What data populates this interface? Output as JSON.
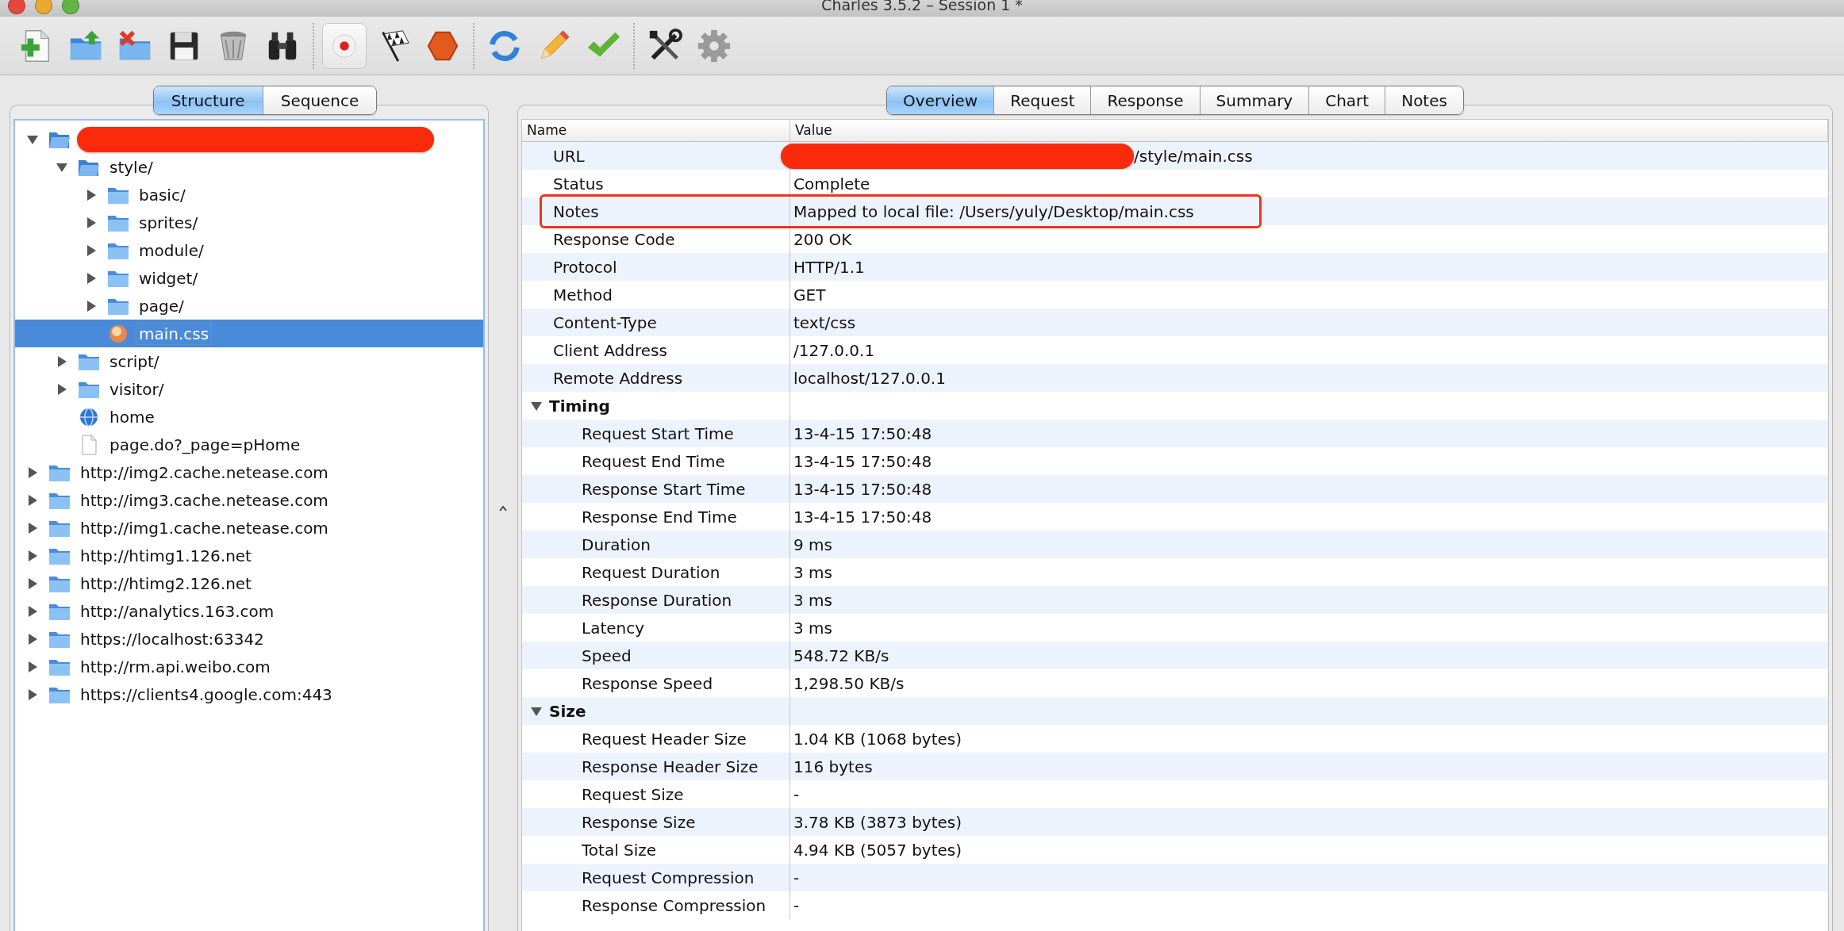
{
  "window": {
    "title": "Charles 3.5.2 – Session 1 *",
    "controls": [
      {
        "color": "#e4473f"
      },
      {
        "color": "#e9a92c"
      },
      {
        "color": "#62b544"
      }
    ]
  },
  "toolbar": [
    {
      "tools": [
        {
          "kind": "new",
          "pressed": false
        },
        {
          "kind": "open",
          "pressed": false
        },
        {
          "kind": "close",
          "pressed": false
        },
        {
          "kind": "save",
          "pressed": false
        },
        {
          "kind": "clear",
          "pressed": false
        },
        {
          "kind": "find",
          "pressed": false
        }
      ]
    },
    {
      "tools": [
        {
          "kind": "record",
          "pressed": true
        },
        {
          "kind": "throttle",
          "pressed": false
        },
        {
          "kind": "stop",
          "pressed": false
        }
      ]
    },
    {
      "tools": [
        {
          "kind": "refresh",
          "pressed": false
        },
        {
          "kind": "edit",
          "pressed": false
        },
        {
          "kind": "validate",
          "pressed": false
        }
      ]
    },
    {
      "tools": [
        {
          "kind": "tools",
          "pressed": false
        },
        {
          "kind": "settings",
          "pressed": false
        }
      ]
    }
  ],
  "left_tabs": [
    {
      "label": "Structure",
      "selected": true
    },
    {
      "label": "Sequence",
      "selected": false
    }
  ],
  "tree": [
    {
      "kind": "folder",
      "redacted": true,
      "expanded": true,
      "selected": false,
      "children": [
        {
          "kind": "folder",
          "label": "style/",
          "expanded": true,
          "selected": false,
          "children": [
            {
              "kind": "folder",
              "label": "basic/",
              "expanded": false,
              "selected": false
            },
            {
              "kind": "folder",
              "label": "sprites/",
              "expanded": false,
              "selected": false
            },
            {
              "kind": "folder",
              "label": "module/",
              "expanded": false,
              "selected": false
            },
            {
              "kind": "folder",
              "label": "widget/",
              "expanded": false,
              "selected": false
            },
            {
              "kind": "folder",
              "label": "page/",
              "expanded": false,
              "selected": false
            },
            {
              "kind": "stylesheet",
              "label": "main.css",
              "selected": true
            }
          ]
        },
        {
          "kind": "folder",
          "label": "script/",
          "expanded": false,
          "selected": false
        },
        {
          "kind": "folder",
          "label": "visitor/",
          "expanded": false,
          "selected": false
        },
        {
          "kind": "globe",
          "label": "home",
          "selected": false
        },
        {
          "kind": "file",
          "label": "page.do?_page=pHome",
          "selected": false
        }
      ]
    },
    {
      "kind": "folder",
      "label": "http://img2.cache.netease.com",
      "expanded": false,
      "selected": false
    },
    {
      "kind": "folder",
      "label": "http://img3.cache.netease.com",
      "expanded": false,
      "selected": false
    },
    {
      "kind": "folder",
      "label": "http://img1.cache.netease.com",
      "expanded": false,
      "selected": false
    },
    {
      "kind": "folder",
      "label": "http://htimg1.126.net",
      "expanded": false,
      "selected": false
    },
    {
      "kind": "folder",
      "label": "http://htimg2.126.net",
      "expanded": false,
      "selected": false
    },
    {
      "kind": "folder",
      "label": "http://analytics.163.com",
      "expanded": false,
      "selected": false
    },
    {
      "kind": "folder",
      "label": "https://localhost:63342",
      "expanded": false,
      "selected": false
    },
    {
      "kind": "folder",
      "label": "http://rm.api.weibo.com",
      "expanded": false,
      "selected": false
    },
    {
      "kind": "folder",
      "label": "https://clients4.google.com:443",
      "expanded": false,
      "selected": false
    }
  ],
  "right_tabs": [
    {
      "label": "Overview",
      "selected": true
    },
    {
      "label": "Request",
      "selected": false
    },
    {
      "label": "Response",
      "selected": false
    },
    {
      "label": "Summary",
      "selected": false
    },
    {
      "label": "Chart",
      "selected": false
    },
    {
      "label": "Notes",
      "selected": false
    }
  ],
  "table": {
    "columns": [
      "Name",
      "Value"
    ],
    "rows": [
      {
        "kind": "field",
        "name": "URL",
        "value": "/style/main.css",
        "redacted": true,
        "highlighted": false
      },
      {
        "kind": "field",
        "name": "Status",
        "value": "Complete",
        "highlighted": false
      },
      {
        "kind": "field",
        "name": "Notes",
        "value": "Mapped to local file: /Users/yuly/Desktop/main.css",
        "highlighted": true
      },
      {
        "kind": "field",
        "name": "Response Code",
        "value": "200 OK",
        "highlighted": false
      },
      {
        "kind": "field",
        "name": "Protocol",
        "value": "HTTP/1.1",
        "highlighted": false
      },
      {
        "kind": "field",
        "name": "Method",
        "value": "GET",
        "highlighted": false
      },
      {
        "kind": "field",
        "name": "Content-Type",
        "value": "text/css",
        "highlighted": false
      },
      {
        "kind": "field",
        "name": "Client Address",
        "value": "/127.0.0.1",
        "highlighted": false
      },
      {
        "kind": "field",
        "name": "Remote Address",
        "value": "localhost/127.0.0.1",
        "highlighted": false
      },
      {
        "kind": "group",
        "name": "Timing",
        "expanded": true,
        "children": [
          {
            "kind": "field",
            "name": "Request Start Time",
            "value": "13-4-15 17:50:48",
            "highlighted": false
          },
          {
            "kind": "field",
            "name": "Request End Time",
            "value": "13-4-15 17:50:48",
            "highlighted": false
          },
          {
            "kind": "field",
            "name": "Response Start Time",
            "value": "13-4-15 17:50:48",
            "highlighted": false
          },
          {
            "kind": "field",
            "name": "Response End Time",
            "value": "13-4-15 17:50:48",
            "highlighted": false
          },
          {
            "kind": "field",
            "name": "Duration",
            "value": "9 ms",
            "highlighted": false
          },
          {
            "kind": "field",
            "name": "Request Duration",
            "value": "3 ms",
            "highlighted": false
          },
          {
            "kind": "field",
            "name": "Response Duration",
            "value": "3 ms",
            "highlighted": false
          },
          {
            "kind": "field",
            "name": "Latency",
            "value": "3 ms",
            "highlighted": false
          },
          {
            "kind": "field",
            "name": "Speed",
            "value": "548.72 KB/s",
            "highlighted": false
          },
          {
            "kind": "field",
            "name": "Response Speed",
            "value": "1,298.50 KB/s",
            "highlighted": false
          }
        ]
      },
      {
        "kind": "group",
        "name": "Size",
        "expanded": true,
        "children": [
          {
            "kind": "field",
            "name": "Request Header Size",
            "value": "1.04 KB (1068 bytes)",
            "highlighted": false
          },
          {
            "kind": "field",
            "name": "Response Header Size",
            "value": "116 bytes",
            "highlighted": false
          },
          {
            "kind": "field",
            "name": "Request Size",
            "value": "-",
            "highlighted": false
          },
          {
            "kind": "field",
            "name": "Response Size",
            "value": "3.78 KB (3873 bytes)",
            "highlighted": false
          },
          {
            "kind": "field",
            "name": "Total Size",
            "value": "4.94 KB (5057 bytes)",
            "highlighted": false
          },
          {
            "kind": "field",
            "name": "Request Compression",
            "value": "-",
            "highlighted": false
          },
          {
            "kind": "field",
            "name": "Response Compression",
            "value": "-",
            "highlighted": false
          }
        ]
      }
    ]
  }
}
